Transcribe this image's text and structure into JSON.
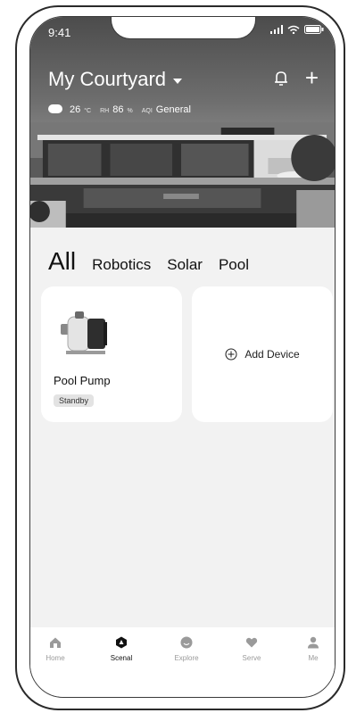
{
  "status_bar": {
    "time": "9:41"
  },
  "header": {
    "title": "My Courtyard"
  },
  "weather": {
    "temperature": "26",
    "temperature_unit": "°C",
    "humidity_label": "RH",
    "humidity": "86",
    "humidity_unit": "%",
    "aqi_label": "AQI",
    "aqi_value": "General"
  },
  "tabs": {
    "all": "All",
    "robotics": "Robotics",
    "solar": "Solar",
    "pool": "Pool"
  },
  "devices": [
    {
      "name": "Pool Pump",
      "status": "Standby"
    }
  ],
  "add_device_label": "Add Device",
  "bottom_nav": [
    {
      "label": "Home"
    },
    {
      "label": "Scenal"
    },
    {
      "label": "Explore"
    },
    {
      "label": "Serve"
    },
    {
      "label": "Me"
    }
  ],
  "colors": {
    "active": "#111111",
    "inactive": "#9a9a9a",
    "card": "#ffffff",
    "background": "#f2f2f2"
  }
}
